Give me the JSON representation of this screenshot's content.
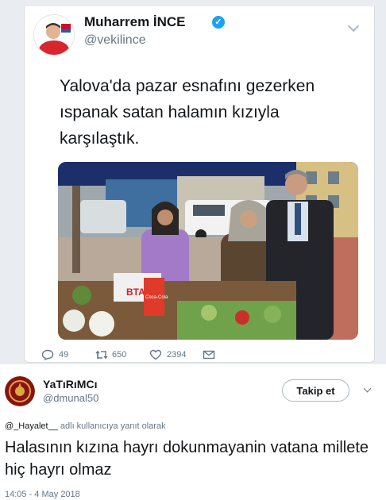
{
  "embedded_tweet": {
    "author_name": "Muharrem İNCE",
    "verified_glyph": "✓",
    "author_handle": "@vekilince",
    "text_lines": [
      "Yalova'da pazar esnafını gezerken",
      "ıspanak satan halamın kızıyla",
      "karşılaştık."
    ],
    "photo_signs": [
      "BTA",
      "Coca-Cola"
    ],
    "actions": {
      "replies": "49",
      "retweets": "650",
      "likes": "2394"
    }
  },
  "reply_tweet": {
    "author_name": "YaTıRıMCı",
    "author_handle": "@dmunal50",
    "follow_label": "Takip et",
    "reply_context_mention": "@_Hayalet__",
    "reply_context_suffix": " adlı kullanıcıya yanıt olarak",
    "text": "Halasının kızına hayrı dokunmayanin vatana millete hiç hayrı olmaz",
    "timestamp": "14:05 - 4 May 2018"
  },
  "colors": {
    "accent": "#1da1f2",
    "muted": "#657786",
    "text": "#14171a"
  },
  "icons": [
    "verified-badge-icon",
    "chevron-down-icon",
    "reply-icon",
    "retweet-icon",
    "like-icon",
    "message-icon"
  ]
}
